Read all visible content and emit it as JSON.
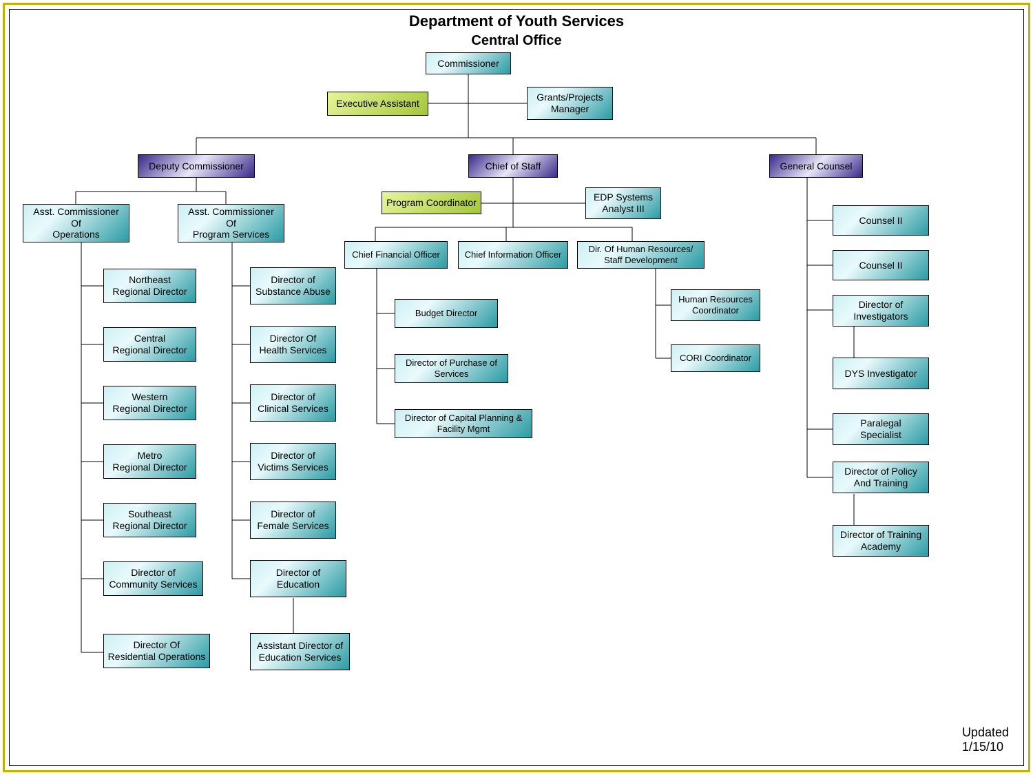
{
  "header": {
    "title1": "Department of Youth Services",
    "title2": "Central Office"
  },
  "footer": {
    "updated_label": "Updated",
    "date": "1/15/10"
  },
  "nodes": {
    "commissioner": "Commissioner",
    "exec_assist": "Executive Assistant",
    "grants_mgr": "Grants/Projects\nManager",
    "deputy_comm": "Deputy Commissioner",
    "chief_staff": "Chief of Staff",
    "gen_counsel": "General Counsel",
    "asst_ops": "Asst. Commissioner\nOf\nOperations",
    "asst_prog": "Asst.  Commissioner\nOf\nProgram Services",
    "ne_dir": "Northeast\nRegional Director",
    "central_dir": "Central\nRegional Director",
    "western_dir": "Western\nRegional Director",
    "metro_dir": "Metro\nRegional Director",
    "se_dir": "Southeast\nRegional Director",
    "comm_svc": "Director of\nCommunity Services",
    "res_ops": "Director Of\nResidential Operations",
    "sub_abuse": "Director of\nSubstance Abuse",
    "health": "Director Of\nHealth Services",
    "clinical": "Director of\nClinical Services",
    "victims": "Director of\nVictims Services",
    "female": "Director of\nFemale Services",
    "education": "Director of Education",
    "asst_edu": "Assistant Director of\nEducation Services",
    "prog_coord": "Program Coordinator",
    "edp": "EDP Systems\nAnalyst III",
    "cfo": "Chief Financial Officer",
    "cio": "Chief Information Officer",
    "hr_dir": "Dir. Of Human Resources/\nStaff Development",
    "budget": "Budget Director",
    "purchase": "Director of Purchase of\nServices",
    "capital": "Director of Capital Planning &\nFacility Mgmt",
    "hr_coord": "Human Resources\nCoordinator",
    "cori": "CORI Coordinator",
    "counsel_a": "Counsel II",
    "counsel_b": "Counsel II",
    "investigators": "Director of\nInvestigators",
    "dys_inv": "DYS Investigator",
    "paralegal": "Paralegal\nSpecialist",
    "policy": "Director of Policy\nAnd Training",
    "training_acad": "Director of Training\nAcademy"
  }
}
